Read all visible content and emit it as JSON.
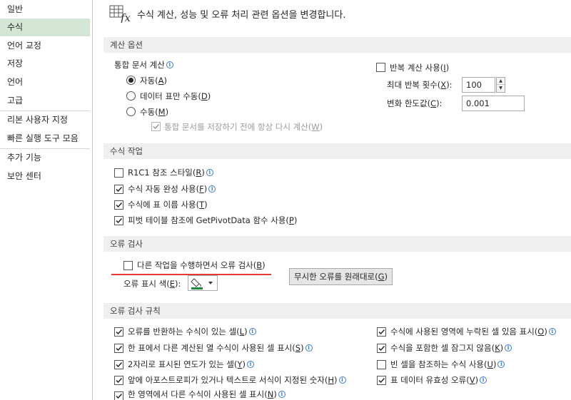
{
  "sidebar": {
    "items": [
      {
        "label": "일반"
      },
      {
        "label": "수식"
      },
      {
        "label": "언어 교정"
      },
      {
        "label": "저장"
      },
      {
        "label": "언어"
      },
      {
        "label": "고급"
      },
      {
        "label": "리본 사용자 지정"
      },
      {
        "label": "빠른 실행 도구 모음"
      },
      {
        "label": "추가 기능"
      },
      {
        "label": "보안 센터"
      }
    ],
    "active_index": 1
  },
  "header": {
    "title": "수식 계산, 성능 및 오류 처리 관련 옵션을 변경합니다."
  },
  "calc": {
    "section": "계산 옵션",
    "workbook_calc_label": "통합 문서 계산",
    "auto": {
      "text": "자동",
      "key": "A",
      "checked": true
    },
    "auto_except": {
      "text": "데이터 표만 수동",
      "key": "D",
      "checked": false
    },
    "manual": {
      "text": "수동",
      "key": "M",
      "checked": false
    },
    "recalc_before_save": {
      "text": "통합 문서를 저장하기 전에 항상 다시 계산",
      "key": "W",
      "checked": true,
      "disabled": true
    },
    "iterative": {
      "text": "반복 계산 사용",
      "key": "I",
      "checked": false
    },
    "max_iter_label": {
      "text": "최대 반복 횟수",
      "key": "X"
    },
    "max_iter_value": "100",
    "max_change_label": {
      "text": "변화 한도값",
      "key": "C"
    },
    "max_change_value": "0.001"
  },
  "formulas": {
    "section": "수식 작업",
    "items": [
      {
        "text": "R1C1 참조 스타일",
        "key": "R",
        "checked": false,
        "info": true
      },
      {
        "text": "수식 자동 완성 사용",
        "key": "F",
        "checked": true,
        "info": true
      },
      {
        "text": "수식에 표 이름 사용",
        "key": "T",
        "checked": true,
        "info": false
      },
      {
        "text": "피벗 테이블 참조에 GetPivotData 함수 사용",
        "key": "P",
        "checked": true,
        "info": false
      }
    ]
  },
  "errcheck": {
    "section": "오류 검사",
    "bg_check": {
      "text": "다른 작업을 수행하면서 오류 검사",
      "key": "B",
      "checked": false
    },
    "color_label": {
      "text": "오류 표시 색",
      "key": "E"
    },
    "indicator_color": "#1e8a3c",
    "reset_button": {
      "text": "무시한 오류를 원래대로",
      "key": "G"
    }
  },
  "rules": {
    "section": "오류 검사 규칙",
    "left": [
      {
        "text": "오류를 반환하는 수식이 있는 셀",
        "key": "L",
        "checked": true
      },
      {
        "text": "한 표에서 다른 계산된 열 수식이 사용된 셀 표시",
        "key": "S",
        "checked": true
      },
      {
        "text": "2자리로 표시된 연도가 있는 셀",
        "key": "Y",
        "checked": true
      },
      {
        "text": "앞에 아포스트로피가 있거나 텍스트로 서식이 지정된 숫자",
        "key": "H",
        "checked": true
      },
      {
        "text": "한 영역에서 다른 수식이 사용된 셀 표시",
        "key": "N",
        "checked": true
      }
    ],
    "right": [
      {
        "text": "수식에 사용된 영역에 누락된 셀 있음 표시",
        "key": "O",
        "checked": true
      },
      {
        "text": "수식을 포함한 셀 잠그지 않음",
        "key": "K",
        "checked": true
      },
      {
        "text": "빈 셀을 참조하는 수식 사용",
        "key": "U",
        "checked": false
      },
      {
        "text": "표 데이터 유효성 오류",
        "key": "V",
        "checked": true
      }
    ]
  },
  "info_glyph": "i"
}
